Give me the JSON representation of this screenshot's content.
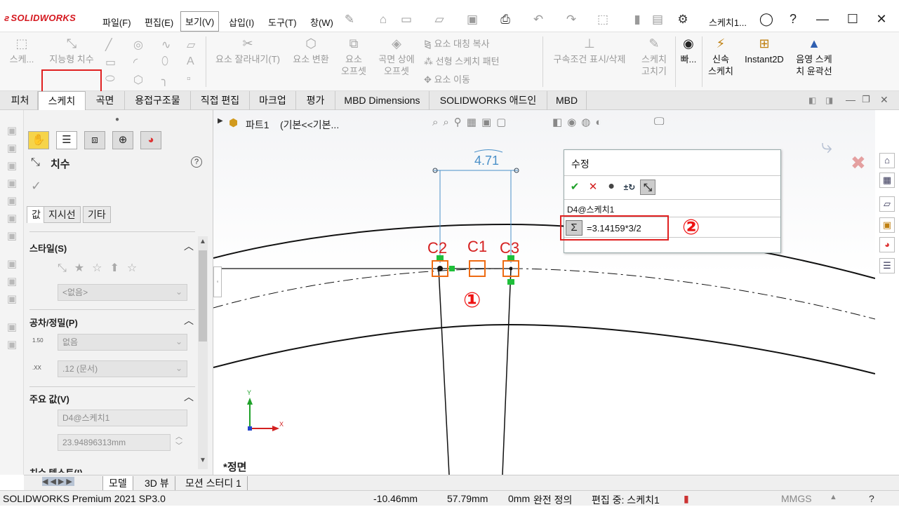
{
  "app": {
    "logo": "SOLIDWORKS",
    "menu": [
      "파일(F)",
      "편집(E)",
      "보기(V)",
      "삽입(I)",
      "도구(T)",
      "창(W)"
    ],
    "active_menu": "보기(V)",
    "doc_title": "스케치1...",
    "window_controls": [
      "minimize-icon",
      "maximize-icon",
      "close-icon"
    ]
  },
  "ribbon": {
    "sketch": "스케...",
    "smart_dimension": "지능형 치수",
    "trim": "요소 잘라내기(T)",
    "convert": "요소 변환",
    "offset": "요소\n오프셋",
    "surface_offset": "곡면 상에\n오프셋",
    "mirror": "요소 대칭 복사",
    "linear_pattern": "선형 스케치 패턴",
    "move": "요소 이동",
    "relations": "구속조건 표시/삭제",
    "repair": "스케치\n고치기",
    "quick_snaps": "빠...",
    "rapid_sketch": "신속\n스케치",
    "instant2d": "Instant2D",
    "shaded_contours": "음영 스케\n치 윤곽선"
  },
  "tabs": [
    "피처",
    "스케치",
    "곡면",
    "용접구조물",
    "직접 편집",
    "마크업",
    "평가",
    "MBD Dimensions",
    "SOLIDWORKS 애드인",
    "MBD"
  ],
  "active_tab": "스케치",
  "feature_tree": {
    "part": "파트1",
    "config": "(기본<<기본..."
  },
  "pm": {
    "title": "치수",
    "subtabs": [
      "값",
      "지시선",
      "기타"
    ],
    "style_label": "스타일(S)",
    "style_value": "<없음>",
    "tolerance_label": "공차/정밀(P)",
    "tolerance_type": "없음",
    "precision": ".12 (문서)",
    "primary_label": "주요 값(V)",
    "primary_name": "D4@스케치1",
    "primary_value": "23.94896313mm",
    "dim_text_label": "치수 텍스트(I)"
  },
  "canvas": {
    "dimension_text": "4.71",
    "view_label": "*정면",
    "labels": {
      "c1": "C1",
      "c2": "C2",
      "c3": "C3"
    },
    "marker1": "①",
    "marker2": "②",
    "axis_x": "X",
    "axis_y": "Y"
  },
  "modify_dialog": {
    "title": "수정",
    "name": "D4@스케치1",
    "value": "=3.14159*3/2"
  },
  "bottom_tabs": [
    "모델",
    "3D 뷰",
    "모션 스터디 1"
  ],
  "active_bottom_tab": "모델",
  "status": {
    "product": "SOLIDWORKS Premium 2021 SP3.0",
    "x": "-10.46mm",
    "y": "57.79mm",
    "z": "0mm",
    "definition": "완전 정의",
    "editing": "편집 중: 스케치1",
    "units": "MMGS"
  },
  "colors": {
    "annotation_red": "#e02020",
    "selection_orange": "#ee6b12",
    "endpoint_green": "#1fbf3a",
    "dimension_blue": "#4a90c8"
  }
}
